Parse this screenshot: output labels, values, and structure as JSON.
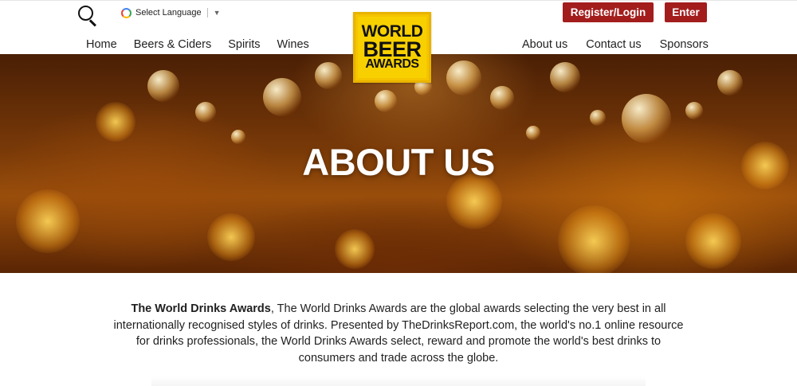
{
  "header": {
    "language_label": "Select Language",
    "language_arrow": "▼",
    "nav_left": [
      "Home",
      "Beers & Ciders",
      "Spirits",
      "Wines"
    ],
    "nav_right": [
      "About us",
      "Contact us",
      "Sponsors"
    ],
    "register_label": "Register/Login",
    "enter_label": "Enter",
    "logo_lines": [
      "WORLD",
      "BEER",
      "AWARDS"
    ]
  },
  "hero": {
    "title": "ABOUT US"
  },
  "intro": {
    "bold_text": "The World Drinks Awards",
    "body_text": ", The World Drinks Awards are the global awards selecting the very best in all internationally recognised styles of drinks. Presented by TheDrinksReport.com, the world's no.1 online resource for drinks professionals, the World Drinks Awards select, reward and promote the world's best drinks to consumers and trade across the globe."
  },
  "colors": {
    "accent": "#a31d1d",
    "logo_yellow": "#f5c400",
    "hero_amber": "#9a4e0b"
  },
  "icons": {
    "search": "search-icon",
    "google": "google-translate-icon"
  }
}
